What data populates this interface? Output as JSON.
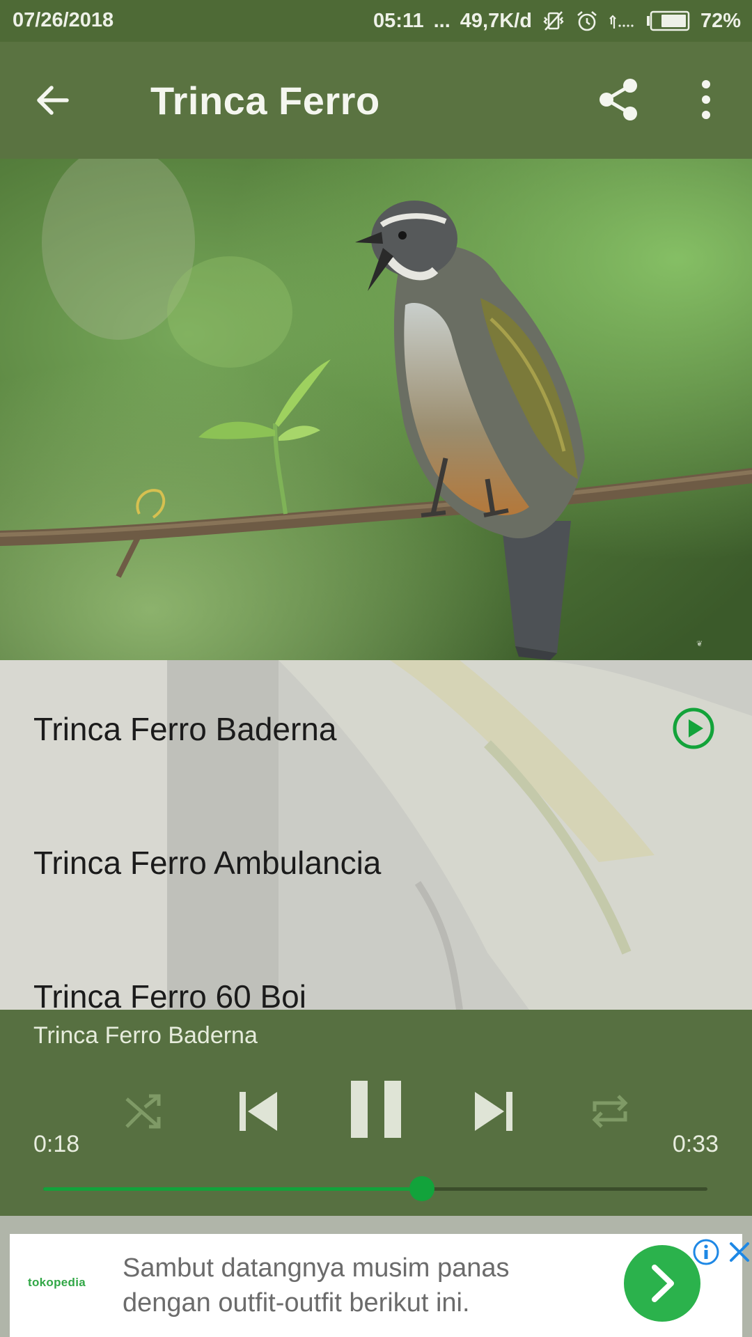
{
  "status_bar": {
    "date": "07/26/2018",
    "time": "05:11",
    "dots": "...",
    "speed": "49,7K/d",
    "battery": "72%"
  },
  "app_bar": {
    "title": "Trinca Ferro",
    "back_icon": "arrow-left-icon",
    "share_icon": "share-icon",
    "more_icon": "more-vert-icon"
  },
  "tracks": [
    {
      "title": "Trinca Ferro Baderna",
      "playing": true
    },
    {
      "title": "Trinca Ferro Ambulancia",
      "playing": false
    },
    {
      "title": "Trinca Ferro 60 Boi",
      "playing": false
    }
  ],
  "player": {
    "now_playing": "Trinca Ferro Baderna",
    "elapsed": "0:18",
    "duration": "0:33",
    "progress": 0.57,
    "controls": [
      "shuffle-icon",
      "skip-previous-icon",
      "pause-icon",
      "skip-next-icon",
      "repeat-icon"
    ]
  },
  "ad": {
    "brand": "tokopedia",
    "line1": "Sambut datangnya musim panas",
    "line2": "dengan outfit-outfit berikut ini."
  },
  "colors": {
    "status_bar": "#4e6a36",
    "app_bar": "#5a7341",
    "accent": "#12a33b",
    "player": "#526c3a"
  }
}
